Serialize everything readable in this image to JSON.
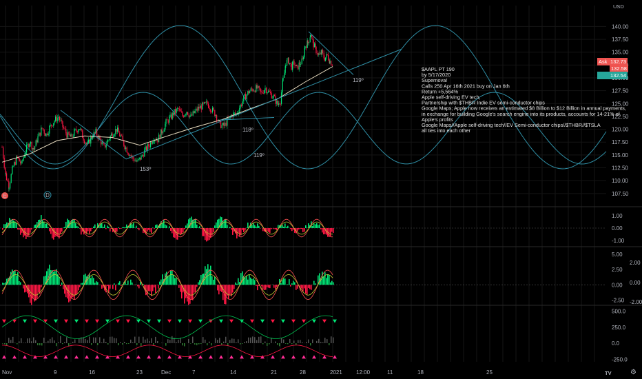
{
  "symbol": "AAPL",
  "currency": "USD",
  "price_axis": {
    "ticks": [
      "140.00",
      "137.50",
      "135.00",
      "132.50",
      "130.00",
      "127.50",
      "125.00",
      "122.50",
      "120.00",
      "117.50",
      "115.00",
      "112.50",
      "110.00",
      "107.50"
    ]
  },
  "price_badges": {
    "ask_label": "Ask",
    "ask_value": "132.73",
    "last_value": "132.58",
    "bid_value": "132.54"
  },
  "osc1_axis": [
    "1.00",
    "0.00",
    "-1.00"
  ],
  "osc2_axis": [
    "5.00",
    "2.50",
    "0.00",
    "-2.50"
  ],
  "osc2_right_axis": [
    "2.00",
    "0.00",
    "-2.00"
  ],
  "osc3_axis": [
    "500.0",
    "250.0",
    "0.0",
    "-250.0"
  ],
  "time_axis": [
    "Nov",
    "9",
    "16",
    "23",
    "Dec",
    "7",
    "14",
    "21",
    "28",
    "2021",
    "12:00",
    "11",
    "18",
    "25"
  ],
  "angle_labels": [
    "153º",
    "118º",
    "119º",
    "119º"
  ],
  "markers": {
    "e": "E",
    "d": "D"
  },
  "annotation": [
    "$AAPL PT 190",
    "by 5/17/2020",
    "Supernova!",
    "Calls 250 Apr 16th 2021 buy on Jan 6th",
    "Return +5,564%",
    "Apple self-driving EV tech,",
    "Partnership with $THBR Indie EV semi-conductor chips",
    "Google Maps; Apple now receives an estimated $8 Billion to $12 Billion in annual payments,",
    "in exchange for building Google's search engine into its products, accounts for 14-21% of",
    "Apple's profits",
    "Google Maps//Apple self-driving tech//EV Semi-conductor chips//$THBR//$TSLA",
    "all ties into each other"
  ],
  "logo": "TV",
  "settings_icon": "gear-icon",
  "colors": {
    "bg": "#000000",
    "up": "#26a69a",
    "down": "#ef5350",
    "green": "#00e676",
    "red": "#ff1744",
    "cyan": "#2f8fa6",
    "ask": "#ef5350",
    "bid": "#26a69a"
  },
  "chart_data": {
    "type": "line",
    "title": "",
    "xlabel": "",
    "ylabel": "",
    "ylim": [
      105.6,
      141.8
    ],
    "price_series": [
      {
        "x": 0,
        "y": 116.5
      },
      {
        "x": 5,
        "y": 111.2
      },
      {
        "x": 10,
        "y": 109.0
      },
      {
        "x": 16,
        "y": 112.8
      },
      {
        "x": 22,
        "y": 114.5
      },
      {
        "x": 28,
        "y": 113.2
      },
      {
        "x": 34,
        "y": 115.8
      },
      {
        "x": 40,
        "y": 117.6
      },
      {
        "x": 46,
        "y": 116.1
      },
      {
        "x": 52,
        "y": 118.4
      },
      {
        "x": 58,
        "y": 120.2
      },
      {
        "x": 64,
        "y": 119.0
      },
      {
        "x": 70,
        "y": 120.6
      },
      {
        "x": 76,
        "y": 121.7
      },
      {
        "x": 82,
        "y": 122.4
      },
      {
        "x": 88,
        "y": 120.5
      },
      {
        "x": 94,
        "y": 119.0
      },
      {
        "x": 100,
        "y": 118.4
      },
      {
        "x": 106,
        "y": 119.6
      },
      {
        "x": 112,
        "y": 120.3
      },
      {
        "x": 118,
        "y": 118.3
      },
      {
        "x": 124,
        "y": 116.9
      },
      {
        "x": 130,
        "y": 118.6
      },
      {
        "x": 136,
        "y": 119.4
      },
      {
        "x": 142,
        "y": 118.0
      },
      {
        "x": 148,
        "y": 116.4
      },
      {
        "x": 154,
        "y": 118.0
      },
      {
        "x": 160,
        "y": 119.2
      },
      {
        "x": 166,
        "y": 120.0
      },
      {
        "x": 172,
        "y": 118.6
      },
      {
        "x": 178,
        "y": 116.8
      },
      {
        "x": 184,
        "y": 115.4
      },
      {
        "x": 190,
        "y": 114.3
      },
      {
        "x": 196,
        "y": 113.6
      },
      {
        "x": 202,
        "y": 114.6
      },
      {
        "x": 208,
        "y": 116.0
      },
      {
        "x": 214,
        "y": 117.0
      },
      {
        "x": 220,
        "y": 118.4
      },
      {
        "x": 226,
        "y": 118.0
      },
      {
        "x": 232,
        "y": 119.6
      },
      {
        "x": 238,
        "y": 121.3
      },
      {
        "x": 244,
        "y": 122.2
      },
      {
        "x": 250,
        "y": 123.3
      },
      {
        "x": 256,
        "y": 123.9
      },
      {
        "x": 262,
        "y": 122.6
      },
      {
        "x": 268,
        "y": 123.6
      },
      {
        "x": 274,
        "y": 122.4
      },
      {
        "x": 280,
        "y": 123.4
      },
      {
        "x": 286,
        "y": 124.2
      },
      {
        "x": 292,
        "y": 124.6
      },
      {
        "x": 298,
        "y": 125.0
      },
      {
        "x": 304,
        "y": 123.9
      },
      {
        "x": 310,
        "y": 122.9
      },
      {
        "x": 316,
        "y": 120.9
      },
      {
        "x": 322,
        "y": 120.6
      },
      {
        "x": 328,
        "y": 121.8
      },
      {
        "x": 334,
        "y": 122.9
      },
      {
        "x": 340,
        "y": 123.0
      },
      {
        "x": 346,
        "y": 124.6
      },
      {
        "x": 352,
        "y": 126.2
      },
      {
        "x": 358,
        "y": 127.3
      },
      {
        "x": 364,
        "y": 127.8
      },
      {
        "x": 370,
        "y": 128.0
      },
      {
        "x": 376,
        "y": 127.0
      },
      {
        "x": 382,
        "y": 128.0
      },
      {
        "x": 388,
        "y": 127.1
      },
      {
        "x": 394,
        "y": 126.3
      },
      {
        "x": 400,
        "y": 124.8
      },
      {
        "x": 404,
        "y": 125.6
      },
      {
        "x": 408,
        "y": 129.6
      },
      {
        "x": 412,
        "y": 133.0
      },
      {
        "x": 416,
        "y": 133.3
      },
      {
        "x": 420,
        "y": 132.2
      },
      {
        "x": 424,
        "y": 132.8
      },
      {
        "x": 428,
        "y": 131.8
      },
      {
        "x": 432,
        "y": 132.8
      },
      {
        "x": 436,
        "y": 133.3
      },
      {
        "x": 440,
        "y": 136.3
      },
      {
        "x": 444,
        "y": 136.8
      },
      {
        "x": 448,
        "y": 138.6
      },
      {
        "x": 452,
        "y": 136.5
      },
      {
        "x": 456,
        "y": 135.3
      },
      {
        "x": 460,
        "y": 134.3
      },
      {
        "x": 464,
        "y": 134.9
      },
      {
        "x": 468,
        "y": 133.8
      },
      {
        "x": 472,
        "y": 134.3
      },
      {
        "x": 476,
        "y": 133.3
      },
      {
        "x": 480,
        "y": 132.6
      }
    ],
    "moving_average": [
      {
        "x": 0,
        "y": 113.6
      },
      {
        "x": 40,
        "y": 115.2
      },
      {
        "x": 80,
        "y": 117.8
      },
      {
        "x": 120,
        "y": 118.7
      },
      {
        "x": 160,
        "y": 118.4
      },
      {
        "x": 200,
        "y": 116.9
      },
      {
        "x": 240,
        "y": 118.7
      },
      {
        "x": 280,
        "y": 120.4
      },
      {
        "x": 320,
        "y": 121.9
      },
      {
        "x": 360,
        "y": 124.0
      },
      {
        "x": 400,
        "y": 125.9
      },
      {
        "x": 440,
        "y": 129.2
      },
      {
        "x": 480,
        "y": 132.2
      }
    ],
    "trendlines": [
      {
        "from": {
          "x": 180,
          "y": 114.2
        },
        "to": {
          "x": 580,
          "y": 135.6
        }
      },
      {
        "from": {
          "x": 180,
          "y": 114.2
        },
        "to": {
          "x": 85,
          "y": 123.7
        }
      },
      {
        "from": {
          "x": 395,
          "y": 122.3
        },
        "to": {
          "x": 316,
          "y": 121.8
        }
      },
      {
        "from": {
          "x": 445,
          "y": 139.0
        },
        "to": {
          "x": 510,
          "y": 130.6
        }
      }
    ],
    "osc1": {
      "ylim": [
        -1.4,
        1.4
      ],
      "base": 0.0
    },
    "osc2": {
      "ylim": [
        -3.0,
        6.0
      ],
      "base": 0.0
    },
    "osc3": {
      "ylim": [
        -290,
        560
      ]
    }
  }
}
